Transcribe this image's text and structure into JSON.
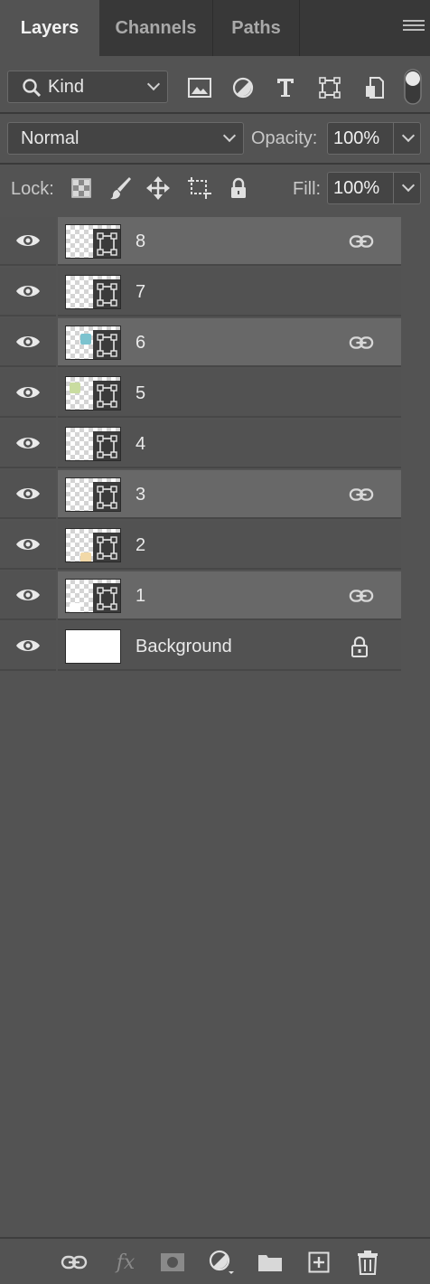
{
  "tabs": [
    {
      "label": "Layers",
      "active": true
    },
    {
      "label": "Channels",
      "active": false
    },
    {
      "label": "Paths",
      "active": false
    }
  ],
  "filter": {
    "kind_label": "Kind"
  },
  "blend": {
    "mode": "Normal",
    "opacity_label": "Opacity:",
    "opacity_value": "100%"
  },
  "lock": {
    "label": "Lock:",
    "fill_label": "Fill:",
    "fill_value": "100%"
  },
  "layers": [
    {
      "name": "8",
      "selected": true,
      "linked": true,
      "swatch": ""
    },
    {
      "name": "7",
      "selected": false,
      "linked": false,
      "swatch": "#5fb8c4"
    },
    {
      "name": "6",
      "selected": true,
      "linked": true,
      "swatch": "#7cc3cf"
    },
    {
      "name": "5",
      "selected": false,
      "linked": false,
      "swatch": "#c9dca0"
    },
    {
      "name": "4",
      "selected": false,
      "linked": false,
      "swatch": ""
    },
    {
      "name": "3",
      "selected": true,
      "linked": true,
      "swatch": ""
    },
    {
      "name": "2",
      "selected": false,
      "linked": false,
      "swatch": "#f2d9a8"
    },
    {
      "name": "1",
      "selected": true,
      "linked": true,
      "swatch": "#ffffff"
    },
    {
      "name": "Background",
      "selected": false,
      "locked": true
    }
  ],
  "colors": {
    "panel": "#535353",
    "selected_row": "#686868",
    "tabbar": "#383838"
  }
}
